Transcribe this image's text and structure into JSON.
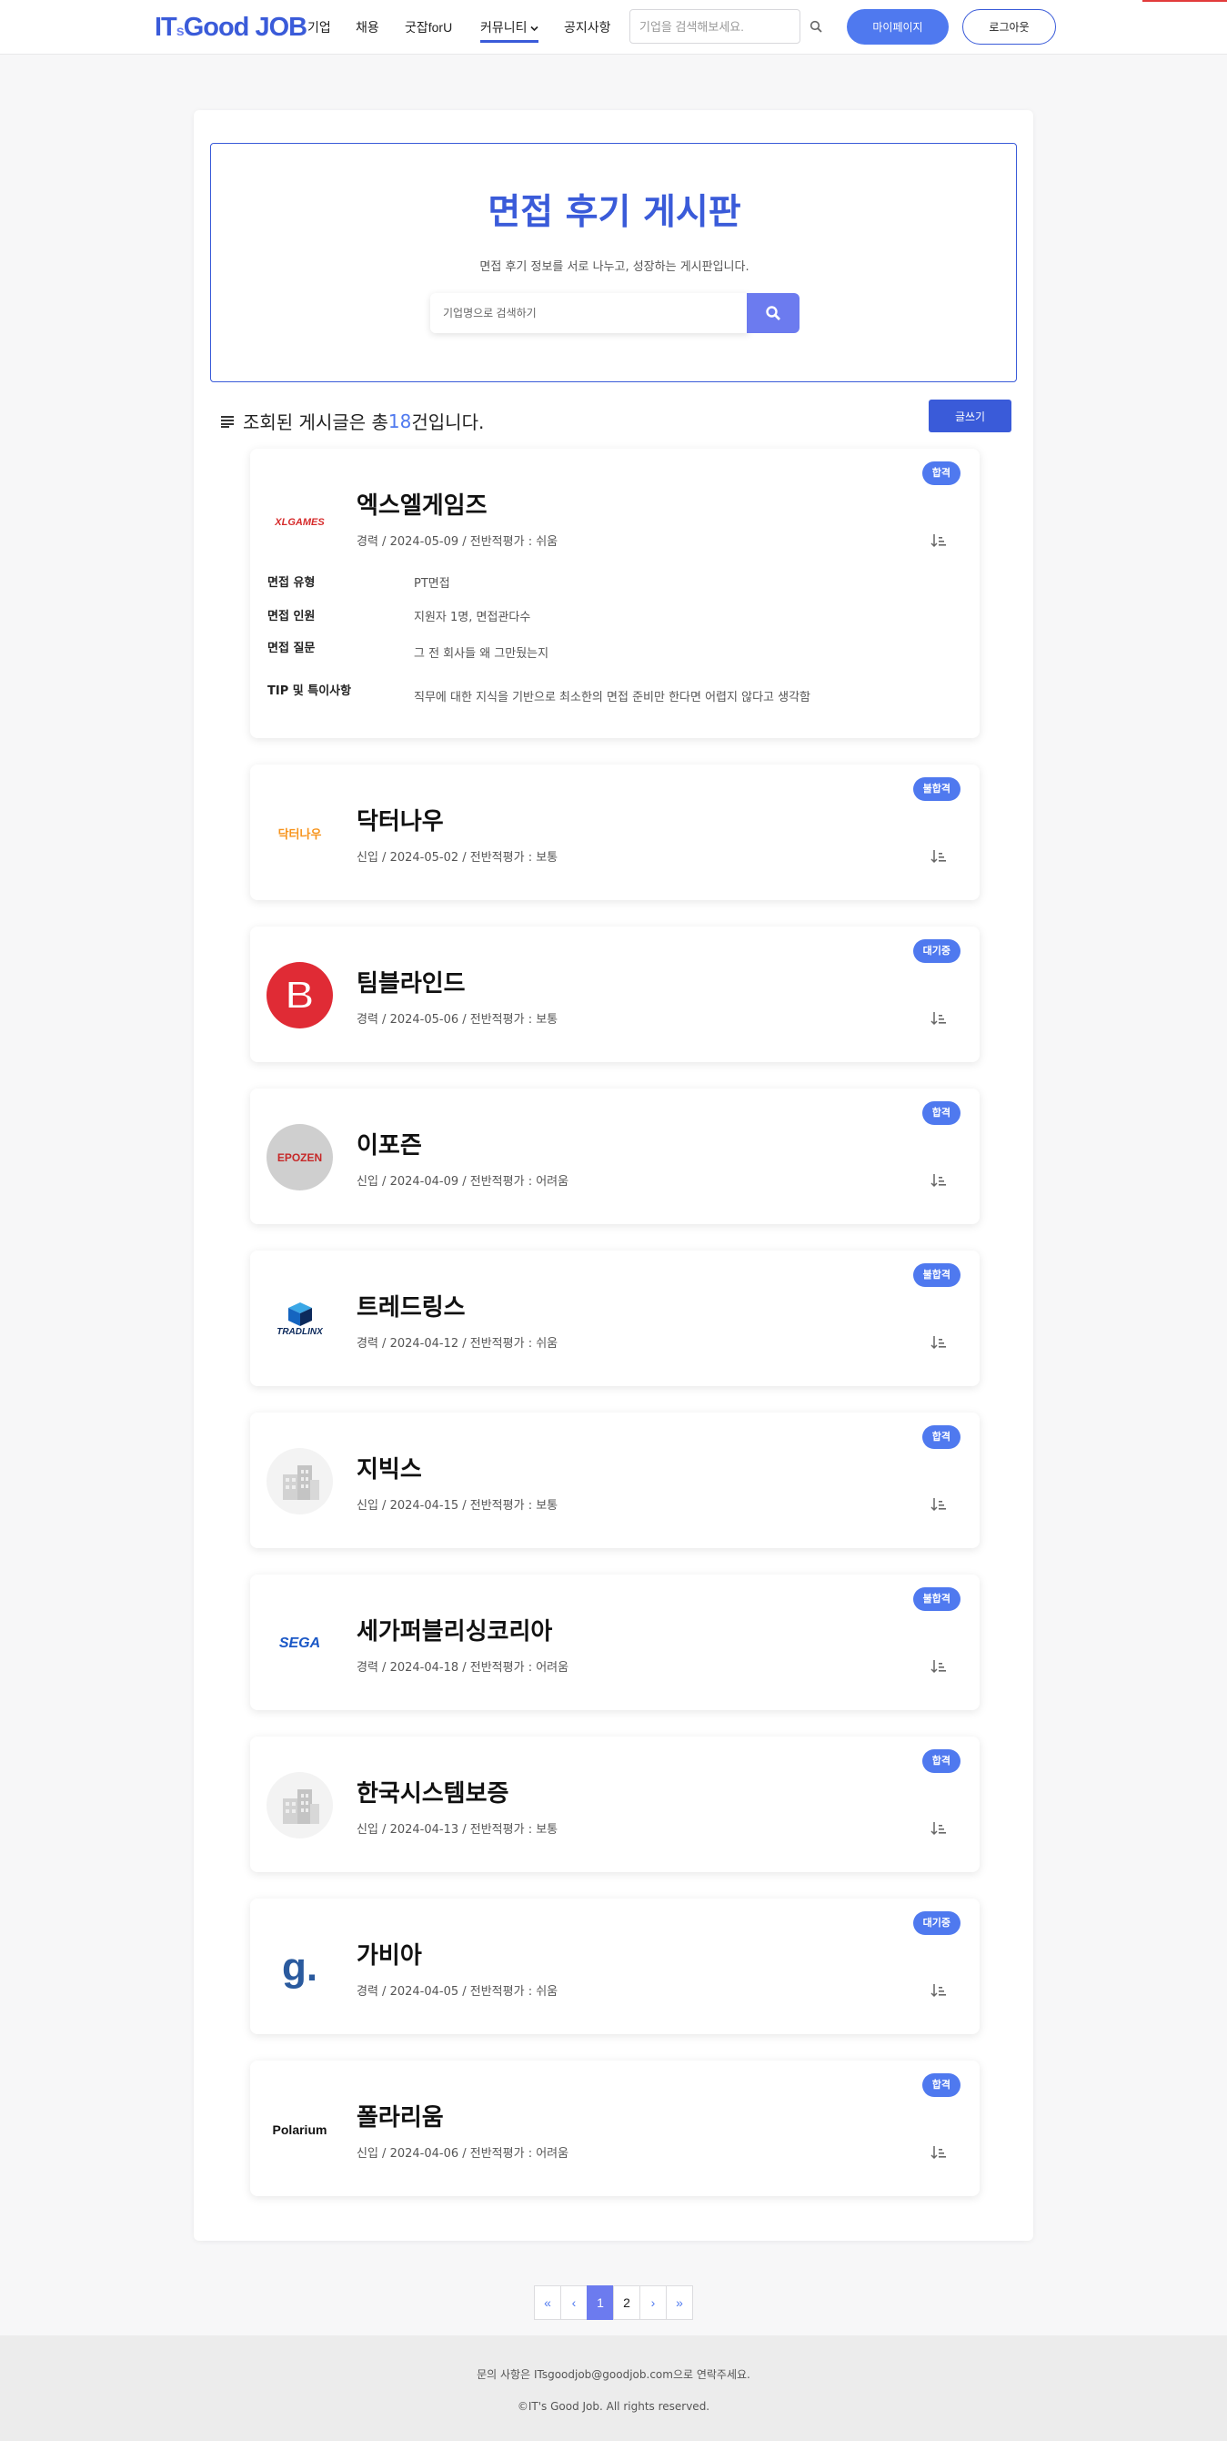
{
  "header": {
    "logo_main": "IT",
    "logo_small": "s",
    "logo_rest": "Good JOB",
    "nav": [
      "기업",
      "채용",
      "굿잡forU",
      "커뮤니티",
      "공지사항"
    ],
    "search_placeholder": "기업을 검색해보세요.",
    "mypage_label": "마이페이지",
    "logout_label": "로그아웃"
  },
  "hero": {
    "title": "면접 후기 게시판",
    "subtitle": "면접 후기 정보를 서로 나누고, 성장하는 게시판입니다.",
    "search_placeholder": "기업명으로 검색하기"
  },
  "summary": {
    "prefix": "조회된 게시글은 총 ",
    "count": "18",
    "suffix": "건입니다.",
    "write_label": "글쓰기"
  },
  "detail_labels": {
    "type": "면접 유형",
    "people": "면접 인원",
    "question": "면접 질문",
    "tip": "TIP 및 특이사항"
  },
  "reviews": [
    {
      "company": "엑스엘게임즈",
      "meta": "경력 / 2024-05-09 / 전반적평가 : 쉬움",
      "badge": "합격",
      "badge_color": "#4f79ef",
      "logo_text": "XLGAMES",
      "detail": {
        "type": "PT면접",
        "people": "지원자 1명, 면접관다수",
        "question": "그 전 회사들 왜 그만뒀는지",
        "tip": "직무에 대한 지식을 기반으로 최소한의 면접 준비만 한다면 어렵지 않다고 생각함"
      }
    },
    {
      "company": "닥터나우",
      "meta": "신입 / 2024-05-02 / 전반적평가 : 보통",
      "badge": "불합격",
      "badge_color": "#4f79ef",
      "logo_text": "닥터나우"
    },
    {
      "company": "팀블라인드",
      "meta": "경력 / 2024-05-06 / 전반적평가 : 보통",
      "badge": "대기중",
      "badge_color": "#4f79ef",
      "logo_text": "B"
    },
    {
      "company": "이포즌",
      "meta": "신입 / 2024-04-09 / 전반적평가 : 어려움",
      "badge": "합격",
      "badge_color": "#4f79ef",
      "logo_text": "EPOZEN"
    },
    {
      "company": "트레드링스",
      "meta": "경력 / 2024-04-12 / 전반적평가 : 쉬움",
      "badge": "불합격",
      "badge_color": "#4f79ef",
      "logo_text": "TRADLINX"
    },
    {
      "company": "지빅스",
      "meta": "신입 / 2024-04-15 / 전반적평가 : 보통",
      "badge": "합격",
      "badge_color": "#4f79ef",
      "logo_text": ""
    },
    {
      "company": "세가퍼블리싱코리아",
      "meta": "경력 / 2024-04-18 / 전반적평가 : 어려움",
      "badge": "불합격",
      "badge_color": "#4f79ef",
      "logo_text": "SEGA"
    },
    {
      "company": "한국시스템보증",
      "meta": "신입 / 2024-04-13 / 전반적평가 : 보통",
      "badge": "합격",
      "badge_color": "#4f79ef",
      "logo_text": ""
    },
    {
      "company": "가비아",
      "meta": "경력 / 2024-04-05 / 전반적평가 : 쉬움",
      "badge": "대기중",
      "badge_color": "#4f79ef",
      "logo_text": "g."
    },
    {
      "company": "폴라리움",
      "meta": "신입 / 2024-04-06 / 전반적평가 : 어려움",
      "badge": "합격",
      "badge_color": "#4f79ef",
      "logo_text": "Polarium"
    }
  ],
  "pagination": {
    "first": "«",
    "prev": "‹",
    "pages": [
      "1",
      "2"
    ],
    "current": "1",
    "next": "›",
    "last": "»"
  },
  "footer": {
    "contact": "문의 사항은 ITsgoodjob@goodjob.com으로 연락주세요.",
    "copyright": "©IT's Good Job. All rights reserved."
  }
}
